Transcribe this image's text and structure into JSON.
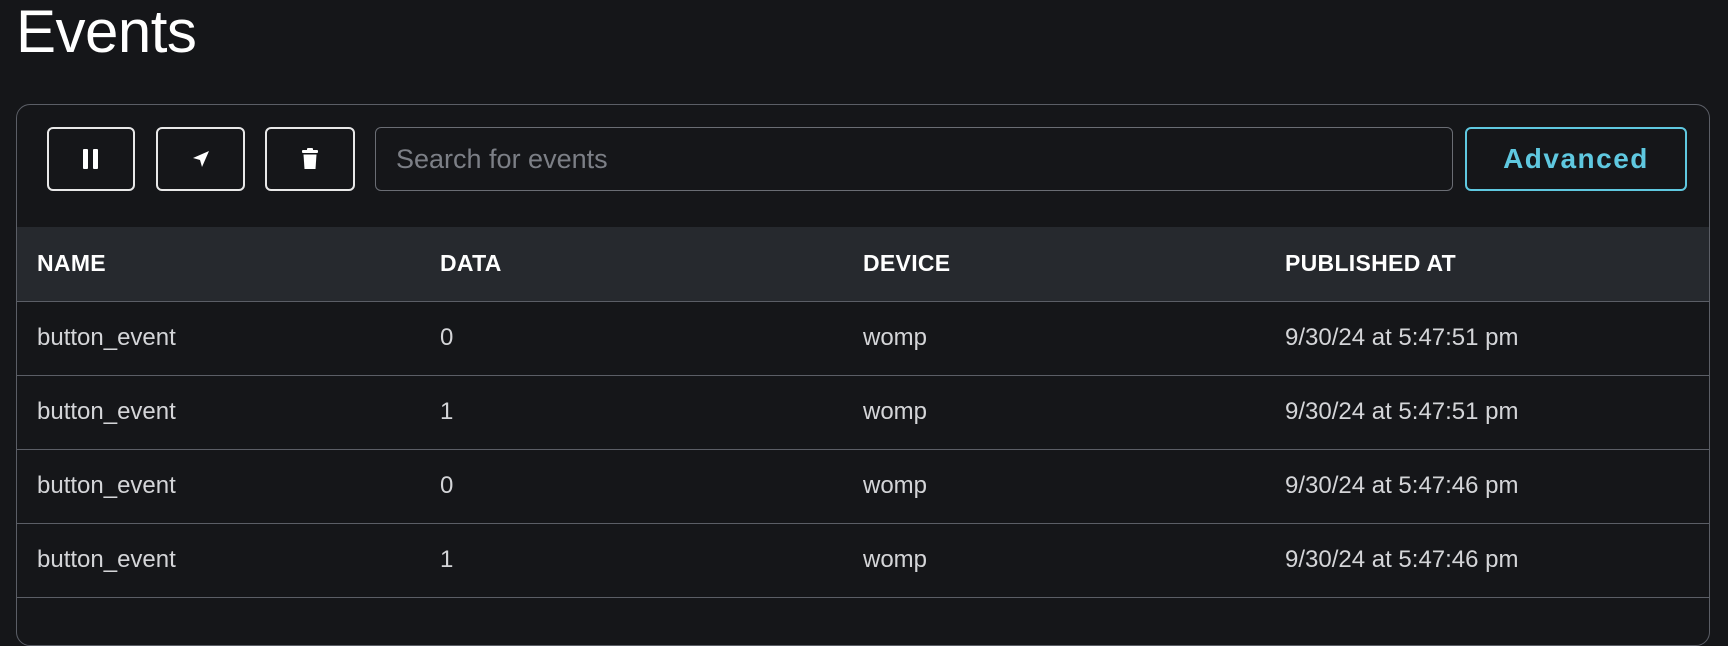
{
  "page": {
    "title": "Events"
  },
  "toolbar": {
    "pause_button": {
      "icon": "pause-icon"
    },
    "publish_button": {
      "icon": "send-icon"
    },
    "clear_button": {
      "icon": "trash-icon"
    },
    "search_placeholder": "Search for events",
    "search_value": "",
    "advanced_label": "Advanced"
  },
  "colors": {
    "background": "#151619",
    "header_bg": "#26292e",
    "accent": "#5fc8e0",
    "border": "#5b5e66"
  },
  "table": {
    "columns": [
      "NAME",
      "DATA",
      "DEVICE",
      "PUBLISHED AT"
    ],
    "rows": [
      [
        "button_event",
        "0",
        "womp",
        "9/30/24 at 5:47:51 pm"
      ],
      [
        "button_event",
        "1",
        "womp",
        "9/30/24 at 5:47:51 pm"
      ],
      [
        "button_event",
        "0",
        "womp",
        "9/30/24 at 5:47:46 pm"
      ],
      [
        "button_event",
        "1",
        "womp",
        "9/30/24 at 5:47:46 pm"
      ]
    ]
  }
}
